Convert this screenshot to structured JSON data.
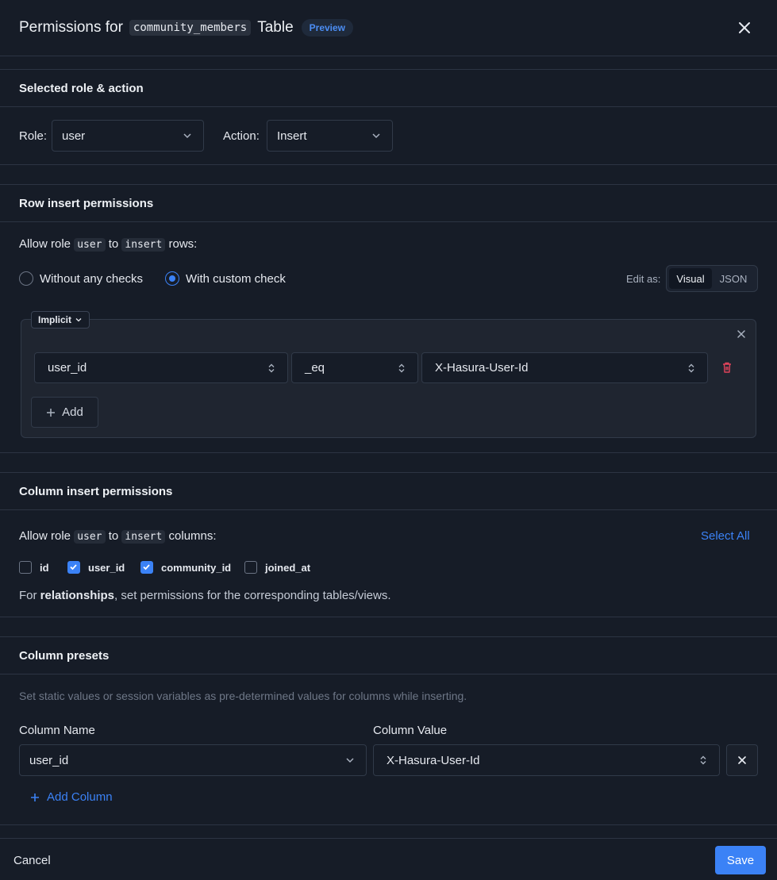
{
  "header": {
    "title_prefix": "Permissions for",
    "table_name": "community_members",
    "title_suffix": "Table",
    "badge": "Preview"
  },
  "role_action": {
    "section_title": "Selected role & action",
    "role_label": "Role:",
    "role_value": "user",
    "action_label": "Action:",
    "action_value": "Insert"
  },
  "row_permissions": {
    "section_title": "Row insert permissions",
    "allow_prefix": "Allow role",
    "role": "user",
    "to": "to",
    "action": "insert",
    "allow_suffix": "rows:",
    "option_none": "Without any checks",
    "option_custom": "With custom check",
    "edit_as_label": "Edit as:",
    "edit_visual": "Visual",
    "edit_json": "JSON",
    "implicit_label": "Implicit",
    "rule": {
      "column": "user_id",
      "operator": "_eq",
      "value": "X-Hasura-User-Id"
    },
    "add_label": "Add"
  },
  "column_permissions": {
    "section_title": "Column insert permissions",
    "allow_prefix": "Allow role",
    "role": "user",
    "to": "to",
    "action": "insert",
    "allow_suffix": "columns:",
    "select_all": "Select All",
    "columns": [
      {
        "name": "id",
        "checked": false
      },
      {
        "name": "user_id",
        "checked": true
      },
      {
        "name": "community_id",
        "checked": true
      },
      {
        "name": "joined_at",
        "checked": false
      }
    ],
    "note_prefix": "For",
    "note_bold": "relationships",
    "note_suffix": ", set permissions for the corresponding tables/views."
  },
  "presets": {
    "section_title": "Column presets",
    "description": "Set static values or session variables as pre-determined values for columns while inserting.",
    "col_name_label": "Column Name",
    "col_value_label": "Column Value",
    "col_name": "user_id",
    "col_value": "X-Hasura-User-Id",
    "add_column": "Add Column"
  },
  "footer": {
    "cancel": "Cancel",
    "save": "Save"
  },
  "colors": {
    "accent": "#3b82f6",
    "danger": "#e0435b"
  }
}
